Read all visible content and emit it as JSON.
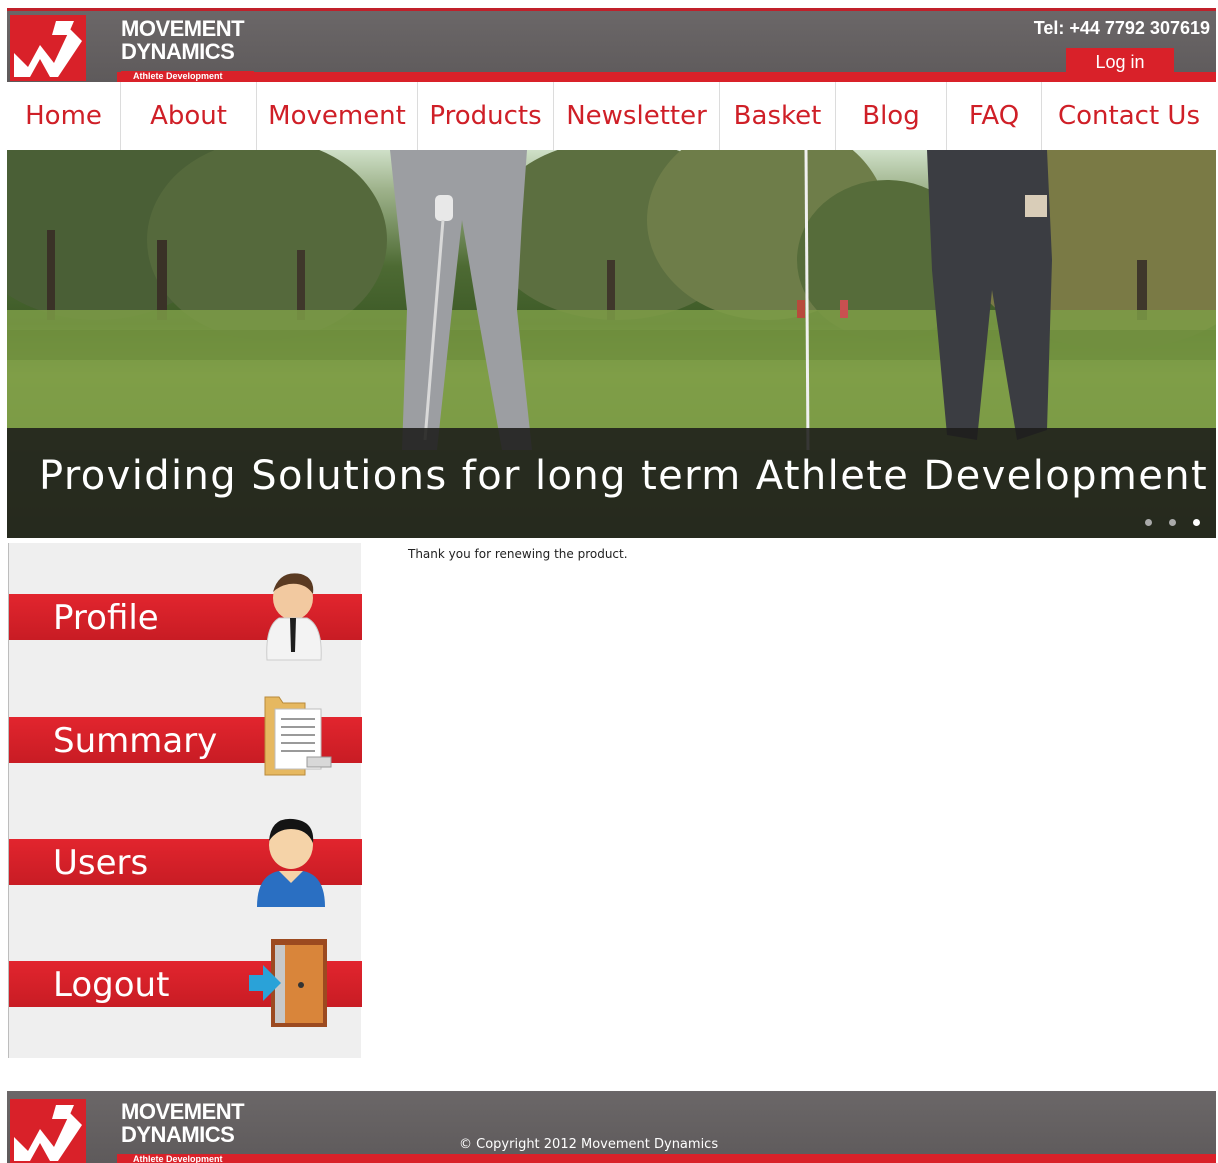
{
  "brand": {
    "name_line1": "MOVEMENT",
    "name_line2": "DYNAMICS",
    "tagline": "Athlete Development",
    "accent_color": "#d92129",
    "header_gray": "#656162"
  },
  "header": {
    "phone": "Tel: +44 7792 307619",
    "login_label": "Log in"
  },
  "nav": {
    "items": [
      {
        "label": "Home"
      },
      {
        "label": "About"
      },
      {
        "label": "Movement"
      },
      {
        "label": "Products"
      },
      {
        "label": "Newsletter"
      },
      {
        "label": "Basket"
      },
      {
        "label": "Blog"
      },
      {
        "label": "FAQ"
      },
      {
        "label": "Contact Us"
      }
    ]
  },
  "banner": {
    "caption": "Providing Solutions for long term Athlete Development",
    "slide_count": 3,
    "active_slide": 3
  },
  "sidebar": {
    "items": [
      {
        "label": "Profile",
        "icon": "profile-person-icon"
      },
      {
        "label": "Summary",
        "icon": "summary-folder-icon"
      },
      {
        "label": "Users",
        "icon": "users-person-icon"
      },
      {
        "label": "Logout",
        "icon": "logout-door-icon"
      }
    ]
  },
  "main": {
    "message": "Thank you for renewing the product."
  },
  "footer": {
    "copyright": "© Copyright 2012 Movement Dynamics"
  }
}
